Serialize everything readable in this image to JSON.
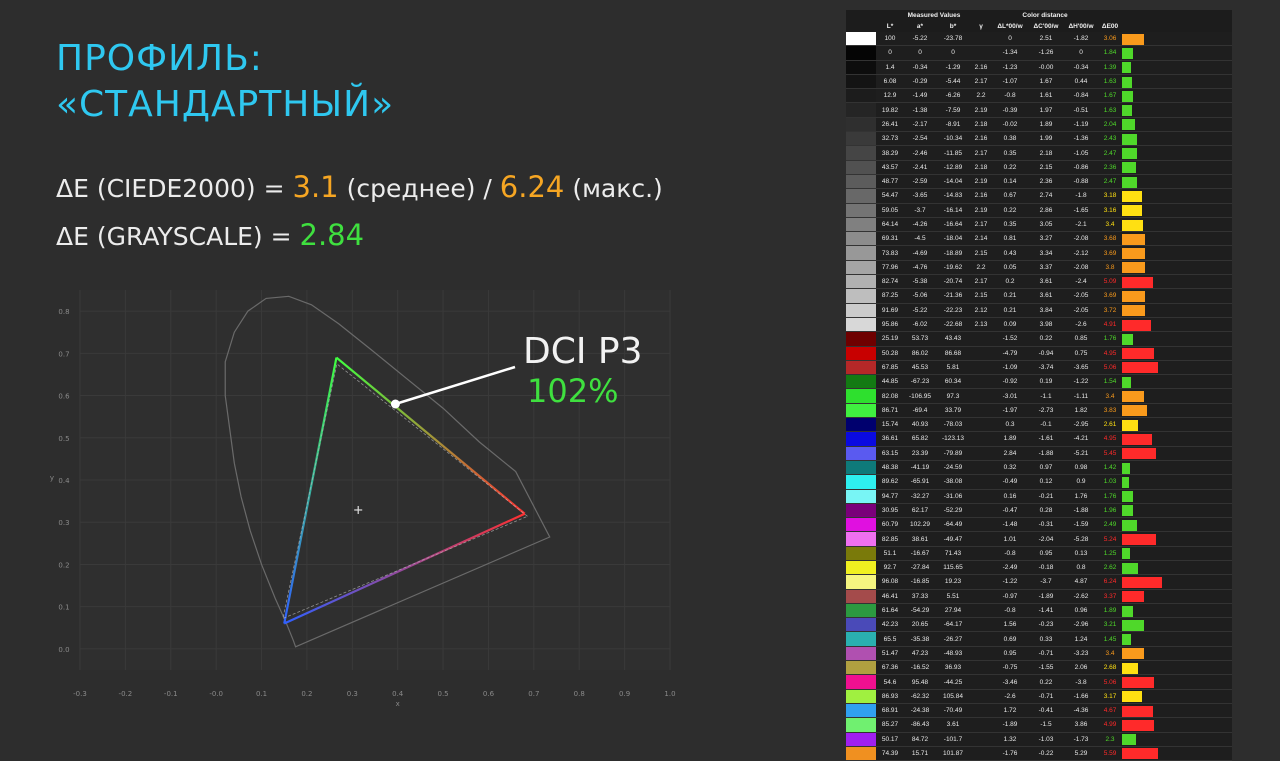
{
  "title_lines": [
    "ПРОФИЛЬ:",
    "«СТАНДАРТНЫЙ»"
  ],
  "metric1": {
    "prefix": "ΔE (CIEDE2000) = ",
    "avg": "3.1",
    "avg_suffix": " (среднее) / ",
    "max": "6.24",
    "max_suffix": " (макс.)"
  },
  "metric2": {
    "prefix": "ΔE (GRAYSCALE) = ",
    "value": "2.84"
  },
  "chart": {
    "label": "DCI P3",
    "coverage": "102%",
    "xlabel": "x",
    "ylabel": "y",
    "x_ticks": [
      "-0.3",
      "-0.2",
      "-0.1",
      "-0.0",
      "0.1",
      "0.2",
      "0.3",
      "0.4",
      "0.5",
      "0.6",
      "0.7",
      "0.8",
      "0.9",
      "1.0"
    ],
    "y_ticks": [
      "0.0",
      "0.1",
      "0.2",
      "0.3",
      "0.4",
      "0.5",
      "0.6",
      "0.7",
      "0.8"
    ]
  },
  "chart_data": {
    "type": "scatter",
    "xlabel": "x",
    "ylabel": "y",
    "xlim": [
      -0.3,
      1.0
    ],
    "ylim": [
      -0.05,
      0.85
    ],
    "grid": true,
    "series": [
      {
        "name": "",
        "points": [
          [
            0.68,
            0.32
          ],
          [
            0.265,
            0.69
          ],
          [
            0.15,
            0.06
          ]
        ]
      },
      {
        "name": "",
        "points": [
          [
            0.686,
            0.314
          ],
          [
            0.266,
            0.675
          ],
          [
            0.147,
            0.072
          ]
        ]
      }
    ],
    "white_point": [
      0.313,
      0.329
    ],
    "callout_point": [
      0.395,
      0.58
    ]
  },
  "table": {
    "group_headers": {
      "measured": "Measured Values",
      "distance": "Color distance"
    },
    "columns": [
      "",
      "L*",
      "a*",
      "b*",
      "γ",
      "ΔL*00/w",
      "ΔC'00/w",
      "ΔH'00/w",
      "ΔE00",
      ""
    ],
    "colors": {
      "green": "#4fd82a",
      "red": "#ff2a2a",
      "orange": "#f99a1c",
      "yellow": "#ffe012"
    },
    "rows": [
      {
        "sw": "#ffffff",
        "L": "100",
        "a": "-5.22",
        "b": "-23.78",
        "g": "",
        "dL": "0",
        "dC": "2.51",
        "dH": "-1.82",
        "de": "3.06",
        "bar": 0.6,
        "bc": "orange"
      },
      {
        "sw": "#050505",
        "L": "0",
        "a": "0",
        "b": "0",
        "g": "",
        "dL": "-1.34",
        "dC": "-1.26",
        "dH": "0",
        "de": "1.84",
        "bar": 0.3,
        "bc": "green"
      },
      {
        "sw": "#0d0d0d",
        "L": "1.4",
        "a": "-0.34",
        "b": "-1.29",
        "g": "2.16",
        "dL": "-1.23",
        "dC": "-0.00",
        "dH": "-0.34",
        "de": "1.39",
        "bar": 0.25,
        "bc": "green"
      },
      {
        "sw": "#141414",
        "L": "6.08",
        "a": "-0.29",
        "b": "-5.44",
        "g": "2.17",
        "dL": "-1.07",
        "dC": "1.67",
        "dH": "0.44",
        "de": "1.63",
        "bar": 0.28,
        "bc": "green"
      },
      {
        "sw": "#1c1c1c",
        "L": "12.9",
        "a": "-1.49",
        "b": "-6.26",
        "g": "2.2",
        "dL": "-0.8",
        "dC": "1.61",
        "dH": "-0.84",
        "de": "1.67",
        "bar": 0.3,
        "bc": "green"
      },
      {
        "sw": "#252525",
        "L": "19.82",
        "a": "-1.38",
        "b": "-7.59",
        "g": "2.19",
        "dL": "-0.39",
        "dC": "1.97",
        "dH": "-0.51",
        "de": "1.63",
        "bar": 0.28,
        "bc": "green"
      },
      {
        "sw": "#2f2f2f",
        "L": "26.41",
        "a": "-2.17",
        "b": "-8.91",
        "g": "2.18",
        "dL": "-0.02",
        "dC": "1.89",
        "dH": "-1.19",
        "de": "2.04",
        "bar": 0.35,
        "bc": "green"
      },
      {
        "sw": "#3a3a3a",
        "L": "32.73",
        "a": "-2.54",
        "b": "-10.34",
        "g": "2.16",
        "dL": "0.38",
        "dC": "1.99",
        "dH": "-1.36",
        "de": "2.43",
        "bar": 0.42,
        "bc": "green"
      },
      {
        "sw": "#454545",
        "L": "38.29",
        "a": "-2.46",
        "b": "-11.85",
        "g": "2.17",
        "dL": "0.35",
        "dC": "2.18",
        "dH": "-1.05",
        "de": "2.47",
        "bar": 0.42,
        "bc": "green"
      },
      {
        "sw": "#515151",
        "L": "43.57",
        "a": "-2.41",
        "b": "-12.89",
        "g": "2.18",
        "dL": "0.22",
        "dC": "2.15",
        "dH": "-0.86",
        "de": "2.36",
        "bar": 0.4,
        "bc": "green"
      },
      {
        "sw": "#5c5c5c",
        "L": "48.77",
        "a": "-2.59",
        "b": "-14.04",
        "g": "2.19",
        "dL": "0.14",
        "dC": "2.36",
        "dH": "-0.88",
        "de": "2.47",
        "bar": 0.42,
        "bc": "green"
      },
      {
        "sw": "#686868",
        "L": "54.47",
        "a": "-3.65",
        "b": "-14.83",
        "g": "2.16",
        "dL": "0.67",
        "dC": "2.74",
        "dH": "-1.8",
        "de": "3.18",
        "bar": 0.55,
        "bc": "yellow"
      },
      {
        "sw": "#747474",
        "L": "59.05",
        "a": "-3.7",
        "b": "-16.14",
        "g": "2.19",
        "dL": "0.22",
        "dC": "2.86",
        "dH": "-1.65",
        "de": "3.16",
        "bar": 0.55,
        "bc": "yellow"
      },
      {
        "sw": "#808080",
        "L": "64.14",
        "a": "-4.26",
        "b": "-16.64",
        "g": "2.17",
        "dL": "0.35",
        "dC": "3.05",
        "dH": "-2.1",
        "de": "3.4",
        "bar": 0.58,
        "bc": "yellow"
      },
      {
        "sw": "#8c8c8c",
        "L": "69.31",
        "a": "-4.5",
        "b": "-18.04",
        "g": "2.14",
        "dL": "0.81",
        "dC": "3.27",
        "dH": "-2.08",
        "de": "3.68",
        "bar": 0.65,
        "bc": "orange"
      },
      {
        "sw": "#989898",
        "L": "73.83",
        "a": "-4.69",
        "b": "-18.89",
        "g": "2.15",
        "dL": "0.43",
        "dC": "3.34",
        "dH": "-2.12",
        "de": "3.69",
        "bar": 0.65,
        "bc": "orange"
      },
      {
        "sw": "#a5a5a5",
        "L": "77.96",
        "a": "-4.76",
        "b": "-19.62",
        "g": "2.2",
        "dL": "0.05",
        "dC": "3.37",
        "dH": "-2.08",
        "de": "3.8",
        "bar": 0.65,
        "bc": "orange"
      },
      {
        "sw": "#b1b1b1",
        "L": "82.74",
        "a": "-5.38",
        "b": "-20.74",
        "g": "2.17",
        "dL": "0.2",
        "dC": "3.61",
        "dH": "-2.4",
        "de": "5.09",
        "bar": 0.85,
        "bc": "red"
      },
      {
        "sw": "#bebebe",
        "L": "87.25",
        "a": "-5.06",
        "b": "-21.36",
        "g": "2.15",
        "dL": "0.21",
        "dC": "3.61",
        "dH": "-2.05",
        "de": "3.69",
        "bar": 0.65,
        "bc": "orange"
      },
      {
        "sw": "#cbcbcb",
        "L": "91.69",
        "a": "-5.22",
        "b": "-22.23",
        "g": "2.12",
        "dL": "0.21",
        "dC": "3.84",
        "dH": "-2.05",
        "de": "3.72",
        "bar": 0.65,
        "bc": "orange"
      },
      {
        "sw": "#d8d8d8",
        "L": "95.86",
        "a": "-6.02",
        "b": "-22.68",
        "g": "2.13",
        "dL": "0.09",
        "dC": "3.98",
        "dH": "-2.6",
        "de": "4.91",
        "bar": 0.8,
        "bc": "red"
      },
      {
        "sw": "#6e0000",
        "L": "25.19",
        "a": "53.73",
        "b": "43.43",
        "g": "",
        "dL": "-1.52",
        "dC": "0.22",
        "dH": "0.85",
        "de": "1.76",
        "bar": 0.3,
        "bc": "green"
      },
      {
        "sw": "#c80000",
        "L": "50.28",
        "a": "86.02",
        "b": "86.68",
        "g": "",
        "dL": "-4.79",
        "dC": "-0.94",
        "dH": "0.75",
        "de": "4.95",
        "bar": 0.9,
        "bc": "red"
      },
      {
        "sw": "#b52828",
        "L": "67.85",
        "a": "45.53",
        "b": "5.81",
        "g": "",
        "dL": "-1.09",
        "dC": "-3.74",
        "dH": "-3.65",
        "de": "5.06",
        "bar": 1.0,
        "bc": "red"
      },
      {
        "sw": "#137a13",
        "L": "44.85",
        "a": "-67.23",
        "b": "60.34",
        "g": "",
        "dL": "-0.92",
        "dC": "0.19",
        "dH": "-1.22",
        "de": "1.54",
        "bar": 0.25,
        "bc": "green"
      },
      {
        "sw": "#2ee02e",
        "L": "82.08",
        "a": "-106.95",
        "b": "97.3",
        "g": "",
        "dL": "-3.01",
        "dC": "-1.1",
        "dH": "-1.11",
        "de": "3.4",
        "bar": 0.6,
        "bc": "orange"
      },
      {
        "sw": "#40f040",
        "L": "86.71",
        "a": "-69.4",
        "b": "33.79",
        "g": "",
        "dL": "-1.97",
        "dC": "-2.73",
        "dH": "1.82",
        "de": "3.83",
        "bar": 0.7,
        "bc": "orange"
      },
      {
        "sw": "#00006e",
        "L": "15.74",
        "a": "40.93",
        "b": "-78.03",
        "g": "",
        "dL": "0.3",
        "dC": "-0.1",
        "dH": "-2.95",
        "de": "2.61",
        "bar": 0.45,
        "bc": "yellow"
      },
      {
        "sw": "#0a0ae0",
        "L": "36.61",
        "a": "65.82",
        "b": "-123.13",
        "g": "",
        "dL": "1.89",
        "dC": "-1.61",
        "dH": "-4.21",
        "de": "4.95",
        "bar": 0.82,
        "bc": "red"
      },
      {
        "sw": "#5a5af0",
        "L": "63.15",
        "a": "23.39",
        "b": "-79.89",
        "g": "",
        "dL": "2.84",
        "dC": "-1.88",
        "dH": "-5.21",
        "de": "5.45",
        "bar": 0.95,
        "bc": "red"
      },
      {
        "sw": "#0e7a7a",
        "L": "48.38",
        "a": "-41.19",
        "b": "-24.59",
        "g": "",
        "dL": "0.32",
        "dC": "0.97",
        "dH": "0.98",
        "de": "1.42",
        "bar": 0.22,
        "bc": "green"
      },
      {
        "sw": "#2ef0f0",
        "L": "89.62",
        "a": "-65.91",
        "b": "-38.08",
        "g": "",
        "dL": "-0.49",
        "dC": "0.12",
        "dH": "0.9",
        "de": "1.03",
        "bar": 0.2,
        "bc": "green"
      },
      {
        "sw": "#78f5f5",
        "L": "94.77",
        "a": "-32.27",
        "b": "-31.06",
        "g": "",
        "dL": "0.16",
        "dC": "-0.21",
        "dH": "1.76",
        "de": "1.76",
        "bar": 0.3,
        "bc": "green"
      },
      {
        "sw": "#7a007a",
        "L": "30.95",
        "a": "62.17",
        "b": "-52.29",
        "g": "",
        "dL": "-0.47",
        "dC": "0.28",
        "dH": "-1.88",
        "de": "1.96",
        "bar": 0.3,
        "bc": "green"
      },
      {
        "sw": "#e010e0",
        "L": "60.79",
        "a": "102.29",
        "b": "-64.49",
        "g": "",
        "dL": "-1.48",
        "dC": "-0.31",
        "dH": "-1.59",
        "de": "2.49",
        "bar": 0.42,
        "bc": "green"
      },
      {
        "sw": "#f070f0",
        "L": "82.85",
        "a": "38.61",
        "b": "-49.47",
        "g": "",
        "dL": "1.01",
        "dC": "-2.04",
        "dH": "-5.28",
        "de": "5.24",
        "bar": 0.95,
        "bc": "red"
      },
      {
        "sw": "#7a7a0a",
        "L": "51.1",
        "a": "-16.67",
        "b": "71.43",
        "g": "",
        "dL": "-0.8",
        "dC": "0.95",
        "dH": "0.13",
        "de": "1.25",
        "bar": 0.22,
        "bc": "green"
      },
      {
        "sw": "#f0f020",
        "L": "92.7",
        "a": "-27.84",
        "b": "115.65",
        "g": "",
        "dL": "-2.49",
        "dC": "-0.18",
        "dH": "0.8",
        "de": "2.62",
        "bar": 0.45,
        "bc": "green"
      },
      {
        "sw": "#f5f580",
        "L": "96.08",
        "a": "-16.85",
        "b": "19.23",
        "g": "",
        "dL": "-1.22",
        "dC": "-3.7",
        "dH": "4.87",
        "de": "6.24",
        "bar": 1.1,
        "bc": "red"
      },
      {
        "sw": "#a44b4b",
        "L": "46.41",
        "a": "37.33",
        "b": "5.51",
        "g": "",
        "dL": "-0.97",
        "dC": "-1.89",
        "dH": "-2.62",
        "de": "3.37",
        "bar": 0.6,
        "bc": "red"
      },
      {
        "sw": "#2c9a40",
        "L": "61.64",
        "a": "-54.29",
        "b": "27.94",
        "g": "",
        "dL": "-0.8",
        "dC": "-1.41",
        "dH": "0.96",
        "de": "1.89",
        "bar": 0.3,
        "bc": "green"
      },
      {
        "sw": "#4a4ab8",
        "L": "42.23",
        "a": "20.65",
        "b": "-64.17",
        "g": "",
        "dL": "1.56",
        "dC": "-0.23",
        "dH": "-2.96",
        "de": "3.21",
        "bar": 0.6,
        "bc": "green"
      },
      {
        "sw": "#2ab0b0",
        "L": "65.5",
        "a": "-35.38",
        "b": "-26.27",
        "g": "",
        "dL": "0.69",
        "dC": "0.33",
        "dH": "1.24",
        "de": "1.45",
        "bar": 0.25,
        "bc": "green"
      },
      {
        "sw": "#b050b0",
        "L": "51.47",
        "a": "47.23",
        "b": "-48.93",
        "g": "",
        "dL": "0.95",
        "dC": "-0.71",
        "dH": "-3.23",
        "de": "3.4",
        "bar": 0.6,
        "bc": "orange"
      },
      {
        "sw": "#b0a040",
        "L": "67.36",
        "a": "-16.52",
        "b": "36.93",
        "g": "",
        "dL": "-0.75",
        "dC": "-1.55",
        "dH": "2.06",
        "de": "2.68",
        "bar": 0.45,
        "bc": "yellow"
      },
      {
        "sw": "#f01090",
        "L": "54.6",
        "a": "95.48",
        "b": "-44.25",
        "g": "",
        "dL": "-3.46",
        "dC": "0.22",
        "dH": "-3.8",
        "de": "5.06",
        "bar": 0.9,
        "bc": "red"
      },
      {
        "sw": "#a0f040",
        "L": "86.93",
        "a": "-62.32",
        "b": "105.84",
        "g": "",
        "dL": "-2.6",
        "dC": "-0.71",
        "dH": "-1.66",
        "de": "3.17",
        "bar": 0.55,
        "bc": "yellow"
      },
      {
        "sw": "#30a0f0",
        "L": "68.91",
        "a": "-24.38",
        "b": "-70.49",
        "g": "",
        "dL": "1.72",
        "dC": "-0.41",
        "dH": "-4.36",
        "de": "4.67",
        "bar": 0.85,
        "bc": "red"
      },
      {
        "sw": "#70f070",
        "L": "85.27",
        "a": "-86.43",
        "b": "3.61",
        "g": "",
        "dL": "-1.89",
        "dC": "-1.5",
        "dH": "3.86",
        "de": "4.99",
        "bar": 0.88,
        "bc": "red"
      },
      {
        "sw": "#a020f0",
        "L": "50.17",
        "a": "84.72",
        "b": "-101.7",
        "g": "",
        "dL": "1.32",
        "dC": "-1.03",
        "dH": "-1.73",
        "de": "2.3",
        "bar": 0.4,
        "bc": "green"
      },
      {
        "sw": "#f09020",
        "L": "74.39",
        "a": "15.71",
        "b": "101.87",
        "g": "",
        "dL": "-1.76",
        "dC": "-0.22",
        "dH": "5.29",
        "de": "5.59",
        "bar": 1.0,
        "bc": "red"
      }
    ]
  }
}
